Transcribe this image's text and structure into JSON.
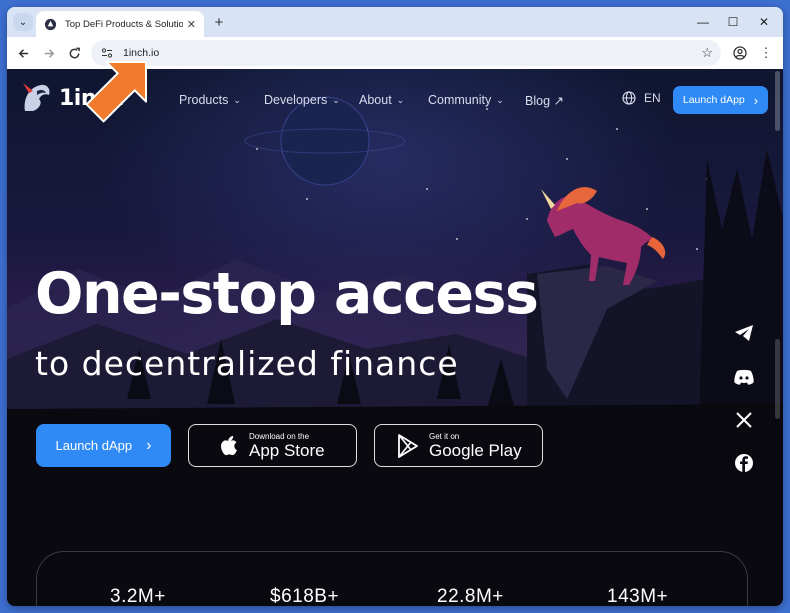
{
  "browser": {
    "tab_title": "Top DeFi Products & Solutions",
    "url": "1inch.io"
  },
  "site": {
    "logo_text": "1inch",
    "nav": [
      {
        "label": "Products"
      },
      {
        "label": "Developers"
      },
      {
        "label": "About"
      },
      {
        "label": "Community"
      },
      {
        "label": "Blog ↗"
      }
    ],
    "language": "EN",
    "launch_top_label": "Launch dApp"
  },
  "hero": {
    "title": "One-stop access",
    "subtitle": "to decentralized finance",
    "cta_label": "Launch dApp",
    "app_store": {
      "small": "Download on the",
      "big": "App Store"
    },
    "google_play": {
      "small": "Get it on",
      "big": "Google Play"
    }
  },
  "social": [
    "telegram-icon",
    "discord-icon",
    "x-icon",
    "facebook-icon"
  ],
  "stats": [
    "3.2M+",
    "$618B+",
    "22.8M+",
    "143M+"
  ],
  "colors": {
    "accent": "#2f8af5",
    "arrow": "#f07b2c",
    "frame": "#3d6fd1"
  }
}
